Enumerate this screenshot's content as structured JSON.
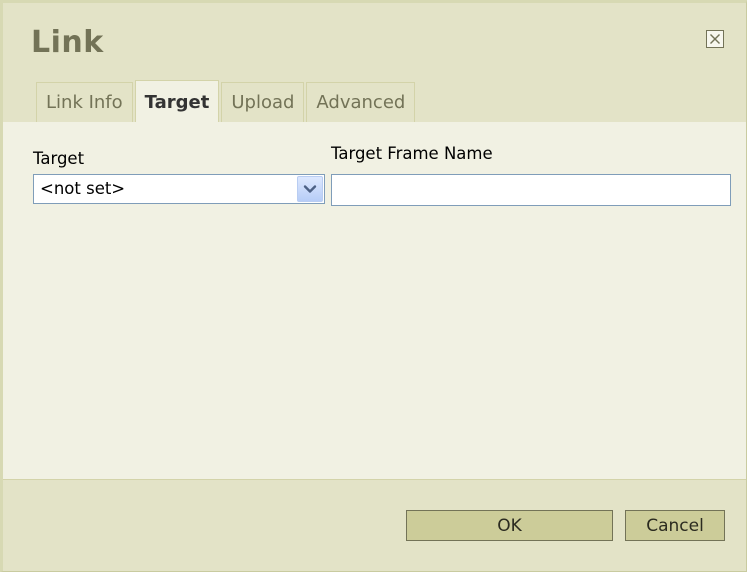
{
  "dialog": {
    "title": "Link",
    "close_icon": "close-icon"
  },
  "tabs": [
    {
      "label": "Link Info",
      "active": false
    },
    {
      "label": "Target",
      "active": true
    },
    {
      "label": "Upload",
      "active": false
    },
    {
      "label": "Advanced",
      "active": false
    }
  ],
  "target": {
    "label": "Target",
    "selected": "<not set>",
    "arrow_icon": "chevron-down-icon"
  },
  "frame_name": {
    "label": "Target Frame Name",
    "value": ""
  },
  "buttons": {
    "ok": "OK",
    "cancel": "Cancel"
  },
  "colors": {
    "header_bg": "#e3e3c7",
    "content_bg": "#f1f1e3",
    "title_text": "#737357",
    "button_bg": "#cccc99",
    "input_border": "#7f9db9"
  }
}
